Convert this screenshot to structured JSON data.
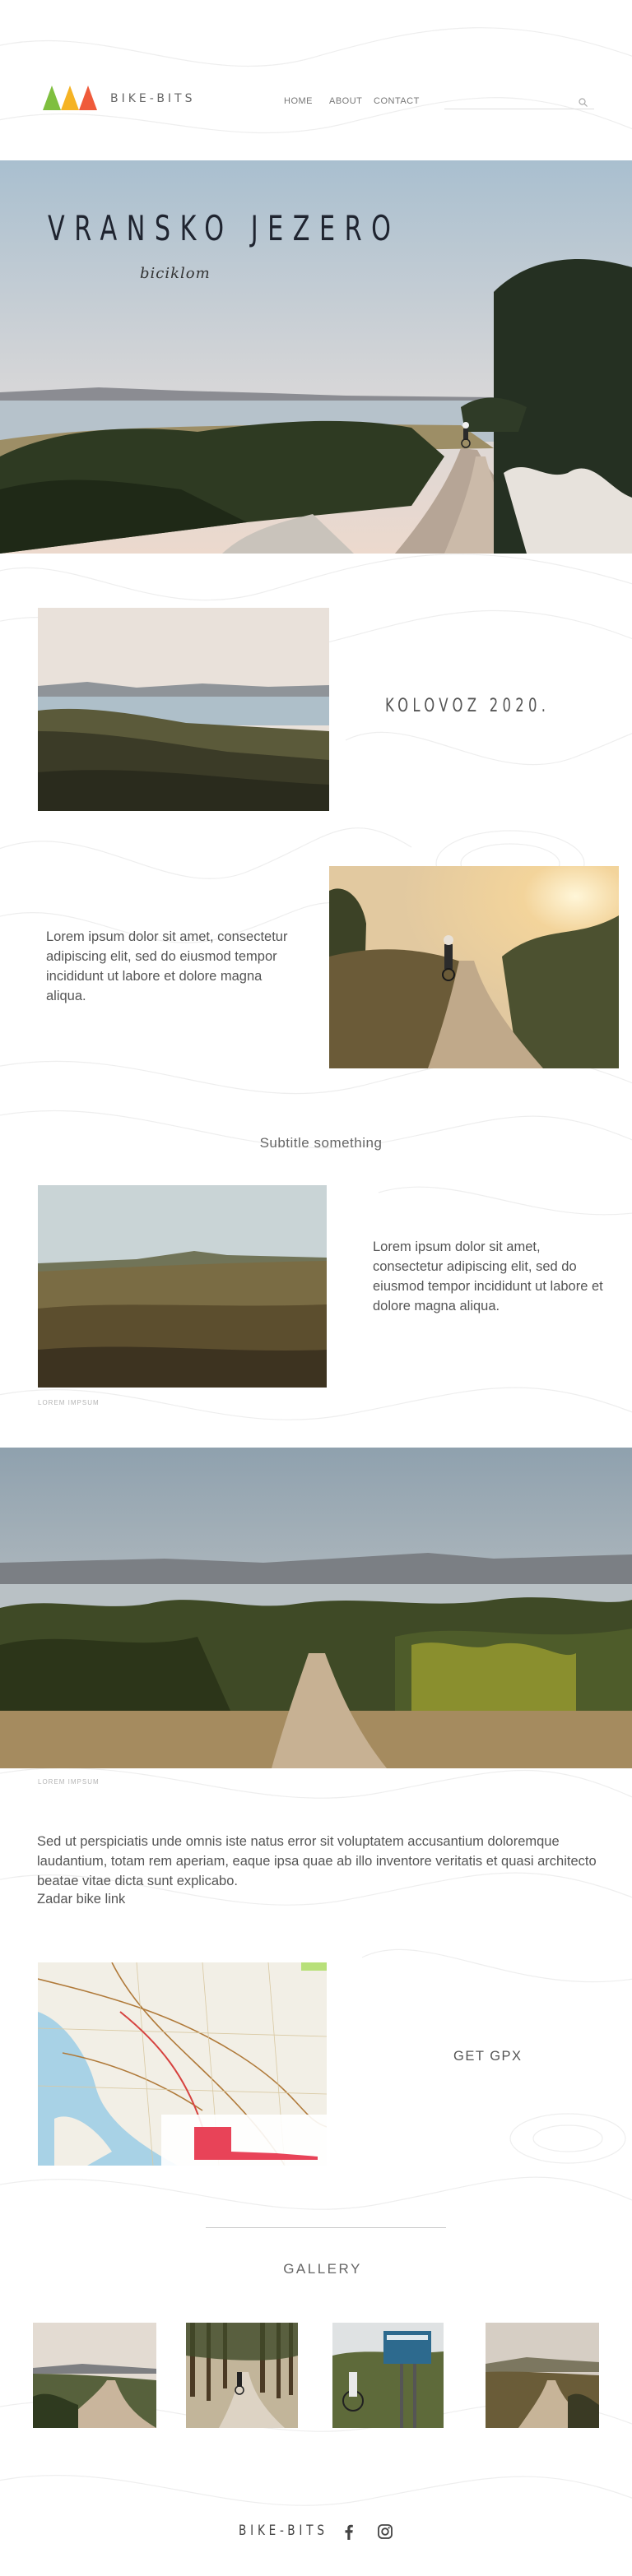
{
  "brand": "BIKE-BITS",
  "logo_colors": [
    "#7fbf3f",
    "#f5b324",
    "#ef5a3a"
  ],
  "nav": {
    "home": "HOME",
    "about": "ABOUT",
    "contact": "CONTACT",
    "search_placeholder": ""
  },
  "hero": {
    "title": "VRANSKO JEZERO",
    "script": "biciklom"
  },
  "date": "KOLOVOZ 2020.",
  "section1": {
    "paragraph": "Lorem ipsum dolor sit amet, consectetur adipiscing elit, sed do eiusmod tempor incididunt ut labore et dolore magna aliqua."
  },
  "subtitle": "Subtitle something",
  "section2": {
    "paragraph": "Lorem ipsum dolor sit amet, consectetur adipiscing elit, sed do eiusmod tempor incididunt ut labore et dolore magna aliqua.",
    "caption": "LOREM IMPSUM"
  },
  "wide_caption": "LOREM IMPSUM",
  "long_paragraph": "Sed ut perspiciatis unde omnis iste natus error sit voluptatem accusantium doloremque laudantium, totam rem aperiam, eaque ipsa quae ab illo inventore veritatis et quasi architecto beatae vitae dicta sunt explicabo.",
  "link_text": "Zadar bike link",
  "gpx_label": "GET GPX",
  "gallery_title": "GALLERY",
  "footer": {
    "brand": "BIKE-BITS",
    "facebook_icon": "facebook-icon",
    "instagram_icon": "instagram-icon"
  }
}
